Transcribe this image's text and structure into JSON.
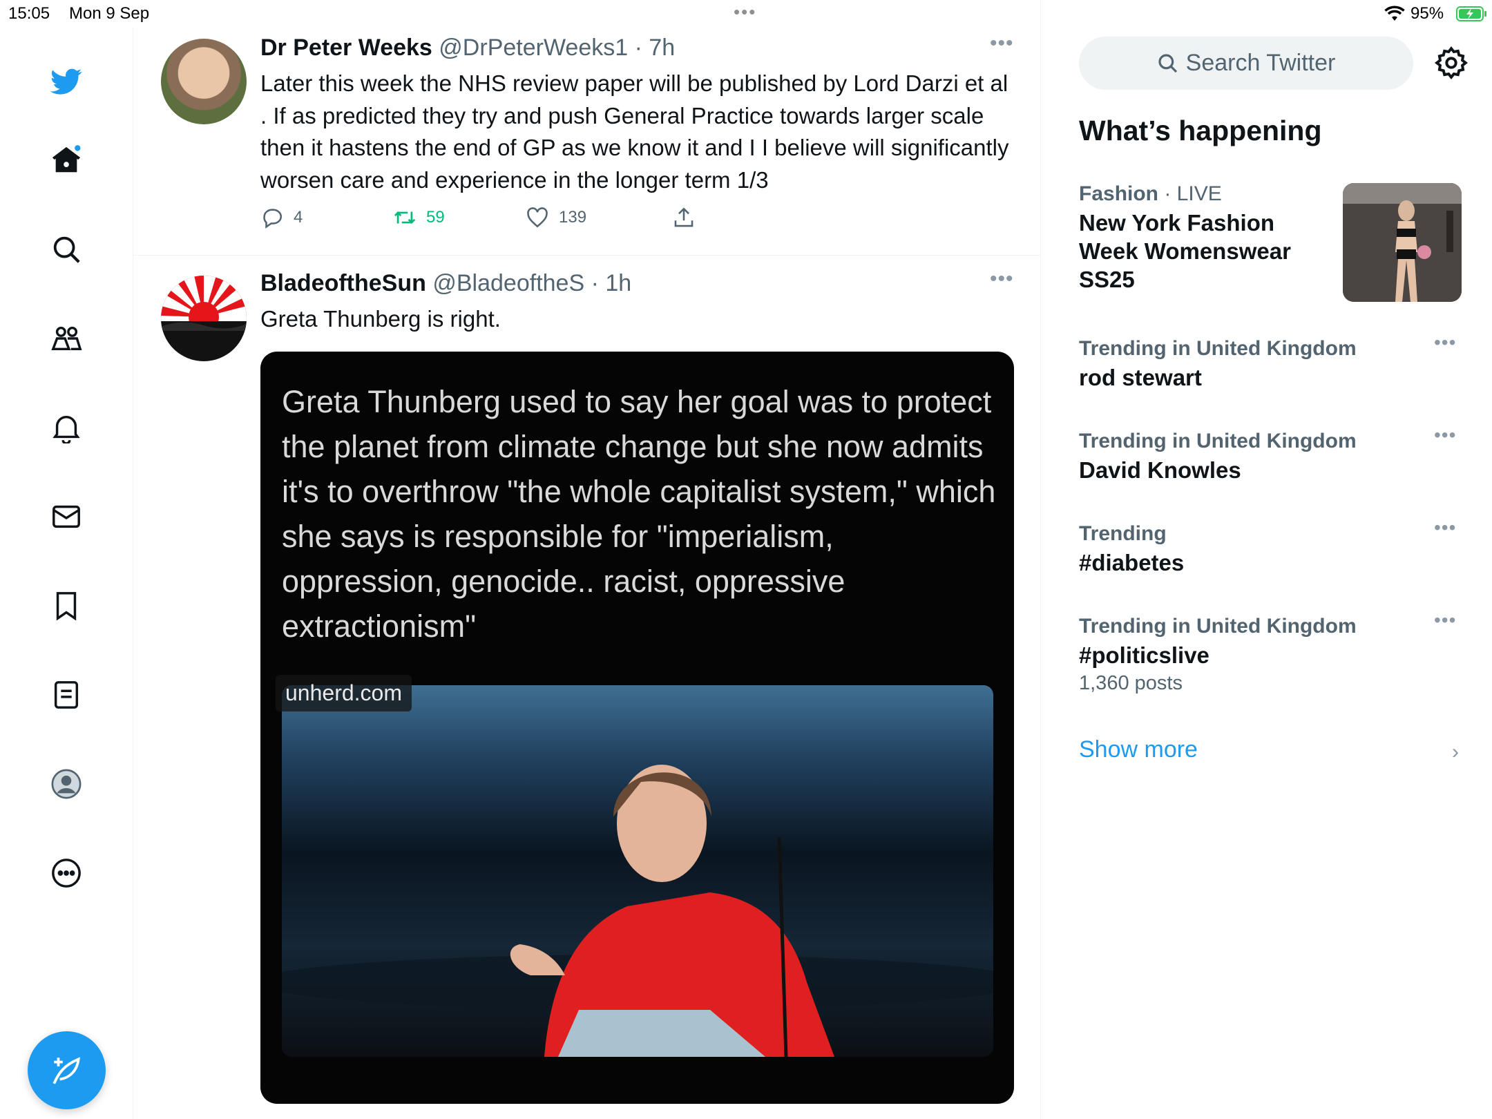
{
  "status_bar": {
    "time": "15:05",
    "date": "Mon 9 Sep",
    "battery_percent": "95%",
    "multitasking_dots": "•••"
  },
  "nav": {
    "items": [
      {
        "icon": "twitter-bird-icon"
      },
      {
        "icon": "home-icon"
      },
      {
        "icon": "search-icon"
      },
      {
        "icon": "communities-icon"
      },
      {
        "icon": "notifications-bell-icon"
      },
      {
        "icon": "messages-envelope-icon"
      },
      {
        "icon": "bookmark-icon"
      },
      {
        "icon": "lists-icon"
      },
      {
        "icon": "profile-avatar-icon"
      },
      {
        "icon": "more-circle-icon"
      }
    ],
    "compose_icon": "compose-feather-icon",
    "accent_color": "#1d9bf0"
  },
  "timeline": {
    "tweets": [
      {
        "name": "Dr Peter Weeks",
        "handle": "@DrPeterWeeks1",
        "time": "· 7h",
        "text": "Later this week the NHS review paper will be published by Lord Darzi et al . If as predicted they try and push General Practice towards larger scale then it hastens the end of GP as we know it and I I believe will significantly worsen care and experience in the longer term 1/3",
        "replies": "4",
        "retweets": "59",
        "likes": "139",
        "more": "•••"
      },
      {
        "name": "BladeoftheSun",
        "handle": "@BladeoftheS",
        "time": "· 1h",
        "text": "Greta Thunberg is right.",
        "more": "•••",
        "media": {
          "quote": "Greta Thunberg used to say her goal was to protect the planet from climate change but she now admits it's to overthrow \"the whole capitalist system,\" which she says is responsible for \"imperialism, oppression, genocide.. racist, oppressive extractionism\"",
          "source": "unherd.com"
        }
      }
    ]
  },
  "sidebar": {
    "search_placeholder": "Search Twitter",
    "happening_title": "What’s happening",
    "trends": [
      {
        "category": "Fashion",
        "live": "· LIVE",
        "title": "New York Fashion Week Womenswear SS25"
      },
      {
        "context": "Trending in United Kingdom",
        "title": "rod stewart",
        "more": "•••"
      },
      {
        "context": "Trending in United Kingdom",
        "title": "David Knowles",
        "more": "•••"
      },
      {
        "context": "Trending",
        "title": "#diabetes",
        "more": "•••"
      },
      {
        "context": "Trending in United Kingdom",
        "title": "#politicslive",
        "posts": "1,360 posts",
        "more": "•••"
      }
    ],
    "show_more": "Show more",
    "chevron": "›"
  }
}
